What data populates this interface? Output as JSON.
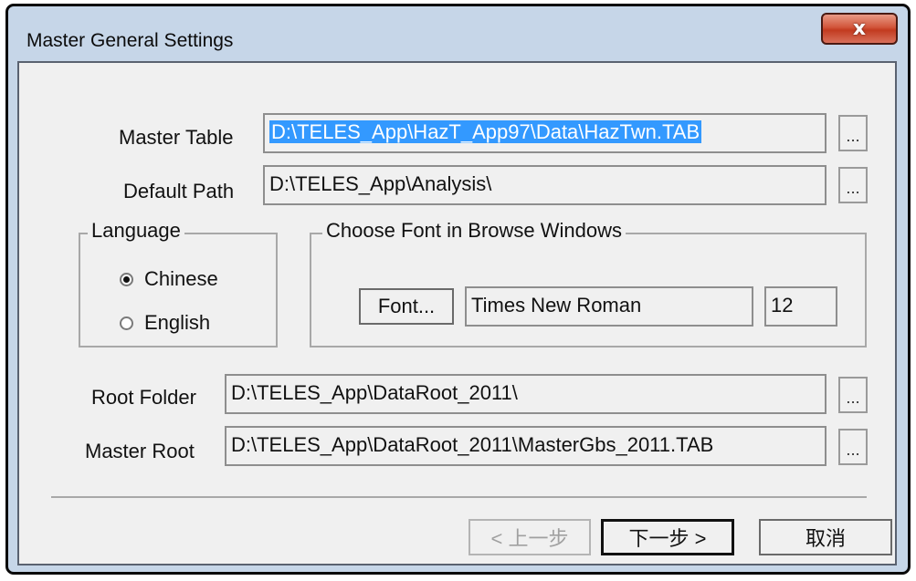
{
  "window": {
    "title": "Master General Settings",
    "close_label": "x"
  },
  "fields": {
    "master_table": {
      "label": "Master Table",
      "value": "D:\\TELES_App\\HazT_App97\\Data\\HazTwn.TAB",
      "browse_label": "..."
    },
    "default_path": {
      "label": "Default Path",
      "value": "D:\\TELES_App\\Analysis\\",
      "browse_label": "..."
    },
    "root_folder": {
      "label": "Root Folder",
      "value": "D:\\TELES_App\\DataRoot_2011\\",
      "browse_label": "..."
    },
    "master_root": {
      "label": "Master Root",
      "value": "D:\\TELES_App\\DataRoot_2011\\MasterGbs_2011.TAB",
      "browse_label": "..."
    }
  },
  "language": {
    "legend": "Language",
    "options": [
      {
        "label": "Chinese",
        "selected": true
      },
      {
        "label": "English",
        "selected": false
      }
    ]
  },
  "font": {
    "legend": "Choose Font in Browse Windows",
    "button_label": "Font...",
    "name": "Times New Roman",
    "size": "12"
  },
  "buttons": {
    "back": "< 上一步",
    "next": "下一步 >",
    "cancel": "取消"
  }
}
